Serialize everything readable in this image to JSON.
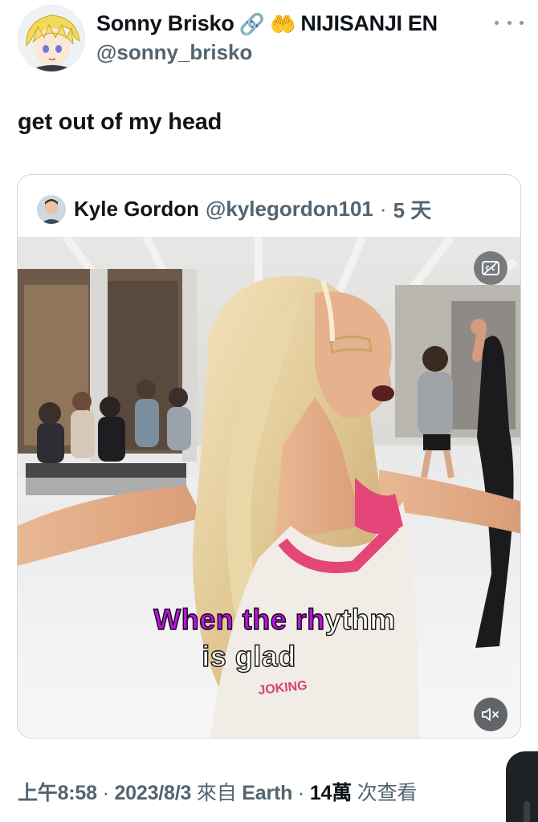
{
  "tweet": {
    "author_name": "Sonny Brisko",
    "author_emoji_1": "🔗",
    "author_emoji_2": "🤲",
    "author_org": "NIJISANJI EN",
    "author_handle": "@sonny_brisko",
    "more_icon": "more-horizontal-icon",
    "text": "get out of my head"
  },
  "quote": {
    "author_name": "Kyle Gordon",
    "author_handle": "@kylegordon101",
    "separator": "·",
    "time": "5 天"
  },
  "video": {
    "caption_line1_highlight_a": "When ",
    "caption_line1_highlight_b": "the ",
    "caption_line1_highlight_c": "rh",
    "caption_line1_plain": "ythm",
    "caption_line2": "is glad",
    "shirt_text": "JOKING",
    "cc_icon": "closed-captions-icon",
    "mute_icon": "volume-muted-icon"
  },
  "meta": {
    "time": "上午8:58",
    "sep1": " · ",
    "date": "2023/8/3",
    "source_prefix": " 來自 ",
    "source": "Earth",
    "sep2": " · ",
    "views_count": "14萬",
    "views_label": " 次查看"
  },
  "colors": {
    "text_primary": "#0f1419",
    "text_secondary": "#536471",
    "border": "#cfd9de",
    "caption_highlight": "#b219d0"
  }
}
